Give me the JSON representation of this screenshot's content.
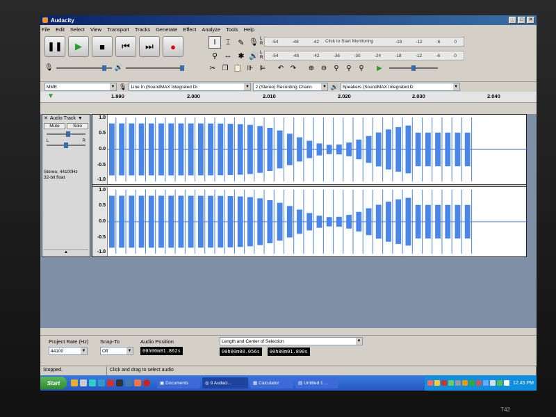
{
  "window": {
    "title": "Audacity",
    "buttons": [
      "_",
      "□",
      "✕"
    ]
  },
  "menu": [
    "File",
    "Edit",
    "Select",
    "View",
    "Transport",
    "Tracks",
    "Generate",
    "Effect",
    "Analyze",
    "Tools",
    "Help"
  ],
  "meters": {
    "monitor_label": "Click to Start Monitoring",
    "record_scale": [
      "-54",
      "-48",
      "-42",
      "",
      "-18",
      "-12",
      "-6",
      "0"
    ],
    "play_scale": [
      "-54",
      "-48",
      "-42",
      "-36",
      "-30",
      "-24",
      "-18",
      "-12",
      "-6",
      "0"
    ],
    "lr": [
      "L",
      "R"
    ]
  },
  "devices": {
    "host": "MME",
    "input": "Line In (SoundMAX Integrated Di",
    "channels": "2 (Stereo) Recording Chann",
    "output": "Speakers (SoundMAX Integrated D"
  },
  "ruler": {
    "ticks": [
      "1.990",
      "2.000",
      "2.010",
      "2.020",
      "2.030",
      "2.040"
    ]
  },
  "track": {
    "name": "Audio Track",
    "mute": "Mute",
    "solo": "Solo",
    "info1": "Stereo, 44100Hz",
    "info2": "32-bit float",
    "pan_l": "L",
    "pan_r": "R",
    "amp_labels": [
      "1.0",
      "0.5",
      "0.0",
      "-0.5",
      "-1.0"
    ],
    "wave_color": "#4a86e8"
  },
  "selection": {
    "project_rate_label": "Project Rate (Hz)",
    "project_rate": "44100",
    "snap_label": "Snap-To",
    "snap": "Off",
    "audio_pos_label": "Audio Position",
    "audio_pos": "00h00m01.862s",
    "sel_mode": "Length and Center of Selection",
    "sel_length": "00h00m00.056s",
    "sel_center": "00h00m01.890s"
  },
  "status": {
    "left": "Stopped.",
    "right": "Click and drag to select audio"
  },
  "taskbar": {
    "start": "Start",
    "tasks": [
      "Documents",
      "9 Audaci...",
      "Calculator",
      "Untitled 1 ..."
    ],
    "clock": "12:45 PM"
  },
  "laptop_model": "T42"
}
